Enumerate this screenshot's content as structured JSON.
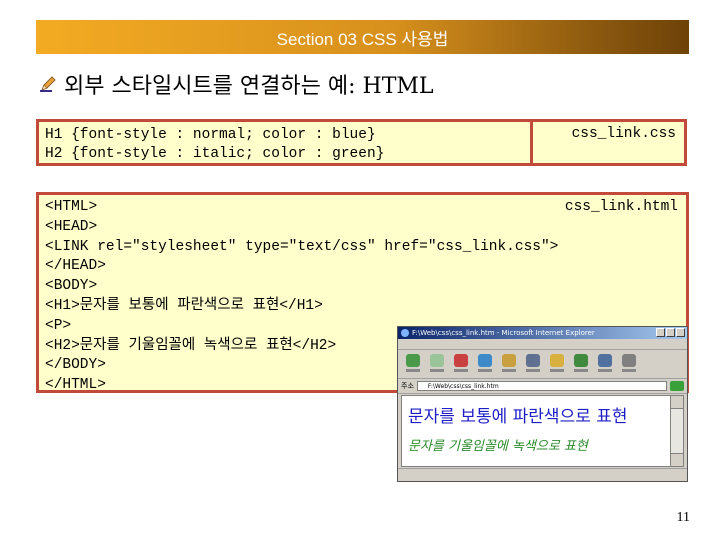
{
  "header": {
    "title": "Section 03 CSS 사용법"
  },
  "heading": {
    "text": "외부 스타일시트를 연결하는 예: HTML"
  },
  "css_file": {
    "lines": [
      "H1 {font-style : normal; color : blue}",
      "H2 {font-style : italic; color : green}"
    ],
    "filename": "css_link.css"
  },
  "html_file": {
    "filename": "css_link.html",
    "lines": [
      "<HTML>",
      "<HEAD>",
      "<LINK rel=\"stylesheet\" type=\"text/css\" href=\"css_link.css\">",
      "</HEAD>",
      "<BODY>",
      "<H1>문자를 보통에 파란색으로 표현</H1>",
      "<P>",
      "<H2>문자를 기울임꼴에 녹색으로 표현</H2>",
      "</BODY>",
      "</HTML>"
    ]
  },
  "browser": {
    "title": "F:\\Web\\css\\css_link.htm - Microsoft Internet Explorer",
    "address": "F:\\Web\\css\\css_link.htm",
    "h1_text": "문자를 보통에 파란색으로 표현",
    "h2_text": "문자를 기울임꼴에 녹색으로 표현"
  },
  "page_number": "11",
  "colors": {
    "header_start": "#f3ab23",
    "header_end": "#6e4208",
    "box_border": "#c24a3a",
    "box_fill": "#ffffcc",
    "h1_blue": "#1e1ec8",
    "h2_green": "#2a8a2a"
  }
}
